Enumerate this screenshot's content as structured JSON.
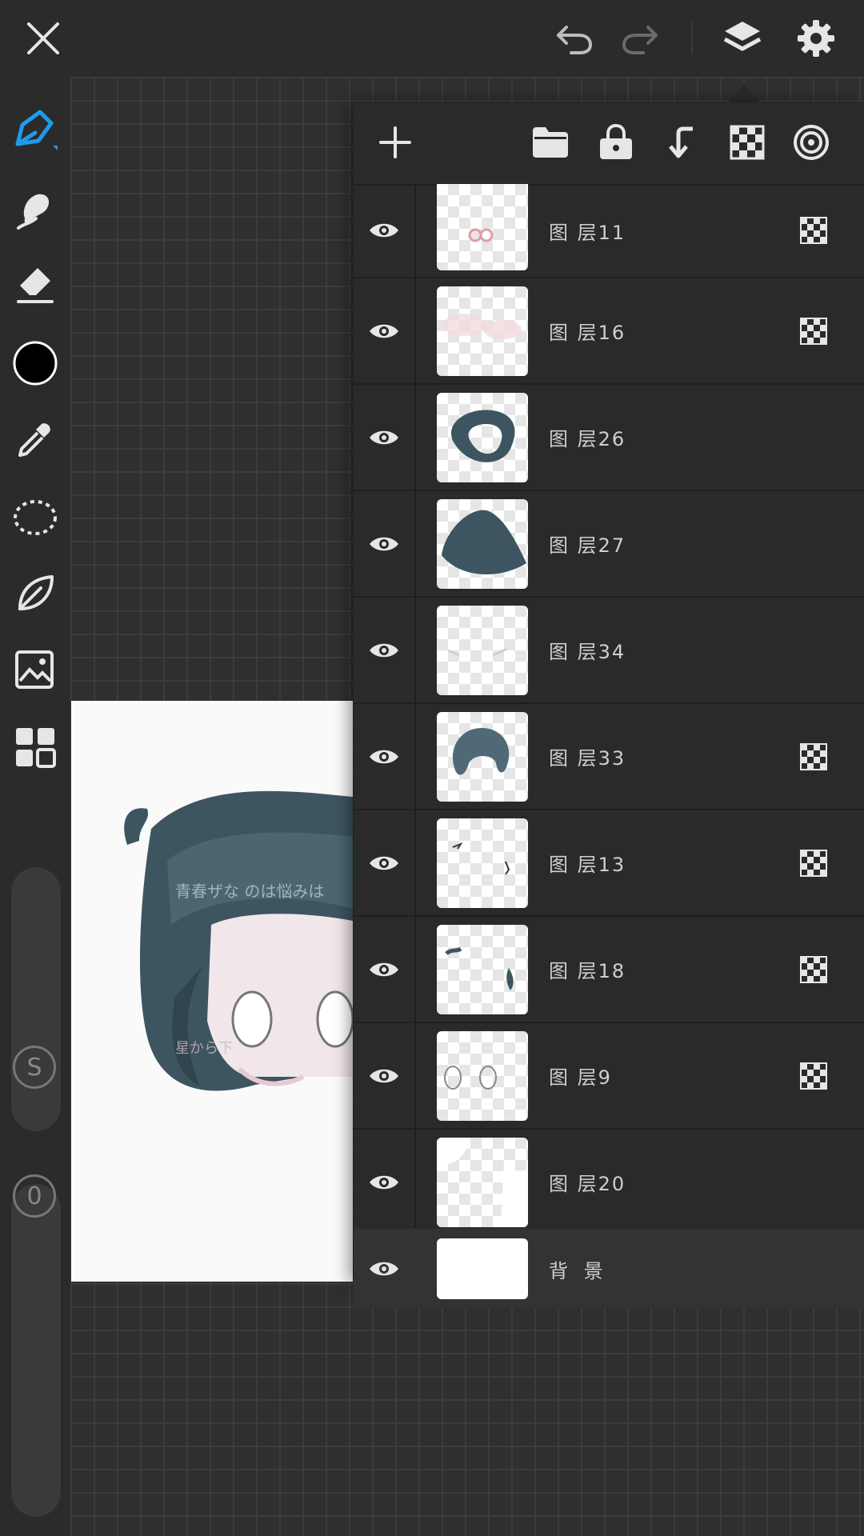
{
  "layers": [
    {
      "name": "图 层11",
      "alpha_lock": true,
      "thumb": "small pink circles"
    },
    {
      "name": "图 层16",
      "alpha_lock": true,
      "thumb": "pink blush"
    },
    {
      "name": "图 层26",
      "alpha_lock": false,
      "thumb": "dark ring"
    },
    {
      "name": "图 层27",
      "alpha_lock": false,
      "thumb": "dark fan shape"
    },
    {
      "name": "图 层34",
      "alpha_lock": false,
      "thumb": "faint strokes"
    },
    {
      "name": "图 层33",
      "alpha_lock": true,
      "thumb": "hair"
    },
    {
      "name": "图 层13",
      "alpha_lock": true,
      "thumb": "small marks"
    },
    {
      "name": "图 层18",
      "alpha_lock": true,
      "thumb": "hair strands"
    },
    {
      "name": "图 层9",
      "alpha_lock": true,
      "thumb": "eye outlines"
    },
    {
      "name": "图 层20",
      "alpha_lock": false,
      "thumb": "white shapes"
    }
  ],
  "background_layer": {
    "name": "背 景"
  },
  "toolbar": {
    "current_color": "#000000",
    "badge_s": "S",
    "badge_0": "0"
  },
  "colors": {
    "accent": "#1e9be8",
    "panel": "#2a2a2a",
    "art_dark": "#3d5560"
  },
  "watermark": {
    "line1": "青春ザな のは悩みは",
    "line2": "星から下"
  }
}
